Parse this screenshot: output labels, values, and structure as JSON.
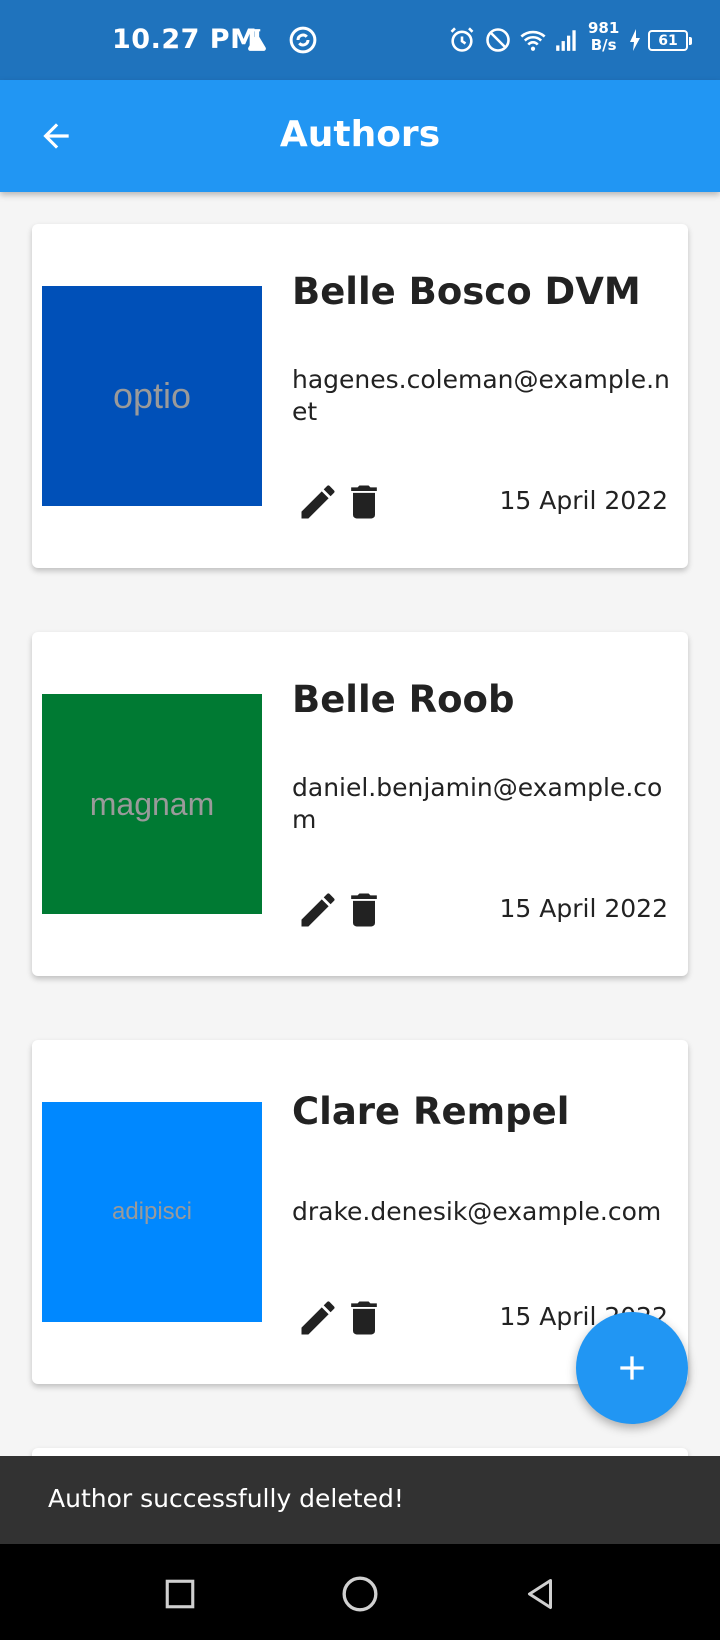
{
  "status_bar": {
    "time": "10.27 PM",
    "net_speed_value": "981",
    "net_speed_unit": "B/s",
    "battery": "61"
  },
  "app_bar": {
    "title": "Authors",
    "back_icon": "arrow-back-icon"
  },
  "authors": [
    {
      "name": "Belle Bosco DVM",
      "email": "hagenes.coleman@example.net",
      "date": "15 April 2022",
      "image_text": "optio",
      "image_color": "#0050b8"
    },
    {
      "name": "Belle Roob",
      "email": "daniel.benjamin@example.com",
      "date": "15 April 2022",
      "image_text": "magnam",
      "image_color": "#007a33"
    },
    {
      "name": "Clare Rempel",
      "email": "drake.denesik@example.com",
      "date": "15 April 2022",
      "image_text": "adipisci",
      "image_color": "#0088ff"
    }
  ],
  "card_icons": {
    "edit": "edit-icon",
    "delete": "delete-icon"
  },
  "fab": {
    "icon": "add-icon"
  },
  "snackbar": {
    "message": "Author successfully deleted!"
  },
  "colors": {
    "primary": "#2196f3",
    "status_bar": "#1f73bd",
    "snackbar": "#323232"
  }
}
